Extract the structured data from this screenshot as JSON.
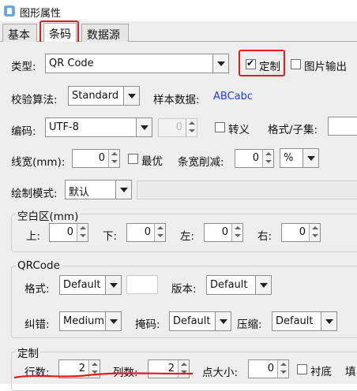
{
  "window": {
    "title": "图形属性"
  },
  "tabs": [
    {
      "label": "基本"
    },
    {
      "label": "条码"
    },
    {
      "label": "数据源"
    }
  ],
  "barcode": {
    "type_label": "类型:",
    "type_value": "QR Code",
    "custom_label": "定制",
    "custom_checked": true,
    "image_output_label": "图片输出",
    "image_output_checked": false,
    "check_algo_label": "校验算法:",
    "check_algo_value": "Standard",
    "sample_label": "样本数据:",
    "sample_value": "ABCabc",
    "encoding_label": "编码:",
    "encoding_value": "UTF-8",
    "encoding_num_value": "0",
    "escape_label": "转义",
    "format_subset_label": "格式/子集:",
    "linewidth_label": "线宽(mm):",
    "linewidth_value": "0",
    "optimal_label": "最优",
    "bar_reduce_label": "条宽削减:",
    "bar_reduce_value": "0",
    "bar_reduce_unit": "%",
    "draw_mode_label": "绘制模式:",
    "draw_mode_value": "默认"
  },
  "quiet_zone": {
    "title": "空白区(mm)",
    "top_label": "上:",
    "top_value": "0",
    "bottom_label": "下:",
    "bottom_value": "0",
    "left_label": "左:",
    "left_value": "0",
    "right_label": "右:",
    "right_value": "0"
  },
  "qrcode": {
    "title": "QRCode",
    "format_label": "格式:",
    "format_value": "Default",
    "version_label": "版本:",
    "version_value": "Default",
    "ecc_label": "纠错:",
    "ecc_value": "Medium",
    "mask_label": "掩码:",
    "mask_value": "Default",
    "compress_label": "压缩:",
    "compress_value": "Default"
  },
  "custom": {
    "title": "定制",
    "rows_label": "行数:",
    "rows_value": "2",
    "cols_label": "列数:",
    "cols_value": "2",
    "dot_size_label": "点大小:",
    "dot_size_value": "0",
    "background_label": "衬底",
    "fill_label": "填"
  },
  "colors": {
    "highlight": "#e21b1b",
    "accent": "#1c3fe0"
  }
}
